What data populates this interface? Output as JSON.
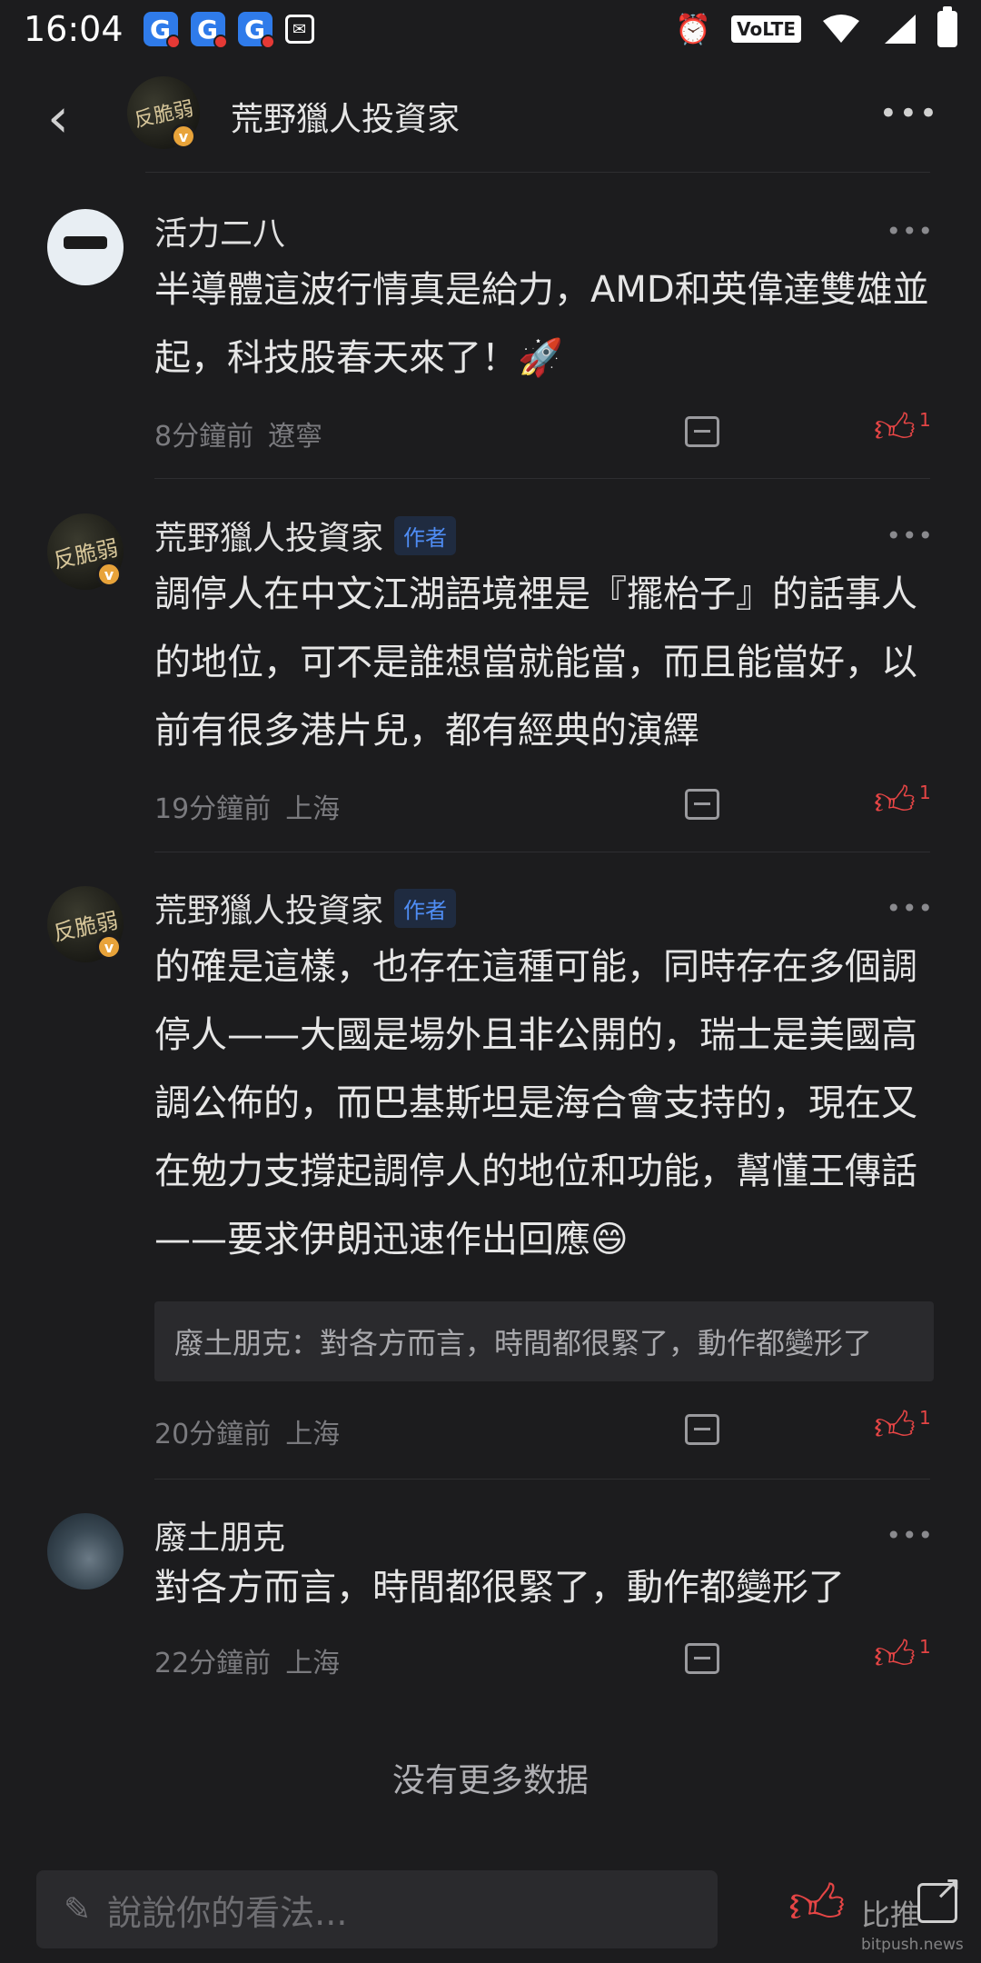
{
  "status_bar": {
    "time": "16:04",
    "notif_letter": "G",
    "volte": "VoLTE"
  },
  "header": {
    "avatar_text": "反脆弱",
    "title": "荒野獵人投資家"
  },
  "comments": [
    {
      "author": "活力二八",
      "is_author": false,
      "text": "半導體這波行情真是給力，AMD和英偉達雙雄並起，科技股春天來了！🚀",
      "time": "8分鐘前",
      "location": "遼寧",
      "likes": "1"
    },
    {
      "author": "荒野獵人投資家",
      "is_author": true,
      "author_tag": "作者",
      "avatar_text": "反脆弱",
      "text": "調停人在中文江湖語境裡是『擺枱子』的話事人的地位，可不是誰想當就能當，而且能當好，以前有很多港片兒，都有經典的演繹",
      "time": "19分鐘前",
      "location": "上海",
      "likes": "1"
    },
    {
      "author": "荒野獵人投資家",
      "is_author": true,
      "author_tag": "作者",
      "avatar_text": "反脆弱",
      "text": "的確是這樣，也存在這種可能，同時存在多個調停人——大國是場外且非公開的，瑞士是美國高調公佈的，而巴基斯坦是海合會支持的，現在又在勉力支撐起調停人的地位和功能，幫懂王傳話——要求伊朗迅速作出回應😄",
      "quote": "廢土朋克：對各方而言，時間都很緊了，動作都變形了",
      "time": "20分鐘前",
      "location": "上海",
      "likes": "1"
    },
    {
      "author": "廢土朋克",
      "is_author": false,
      "text": "對各方而言，時間都很緊了，動作都變形了",
      "time": "22分鐘前",
      "location": "上海",
      "likes": "1"
    }
  ],
  "footer_text": "没有更多数据",
  "bottom_bar": {
    "placeholder": "說說你的看法...",
    "watermark": "比推",
    "watermark_sub": "bitpush.news"
  },
  "colors": {
    "background": "#1c1c1e",
    "like_red": "#e54545",
    "author_tag_blue": "#4f8df5"
  },
  "icons": [
    "back-arrow-icon",
    "more-icon",
    "reply-icon",
    "thumbs-up-icon",
    "pencil-icon",
    "share-icon"
  ]
}
